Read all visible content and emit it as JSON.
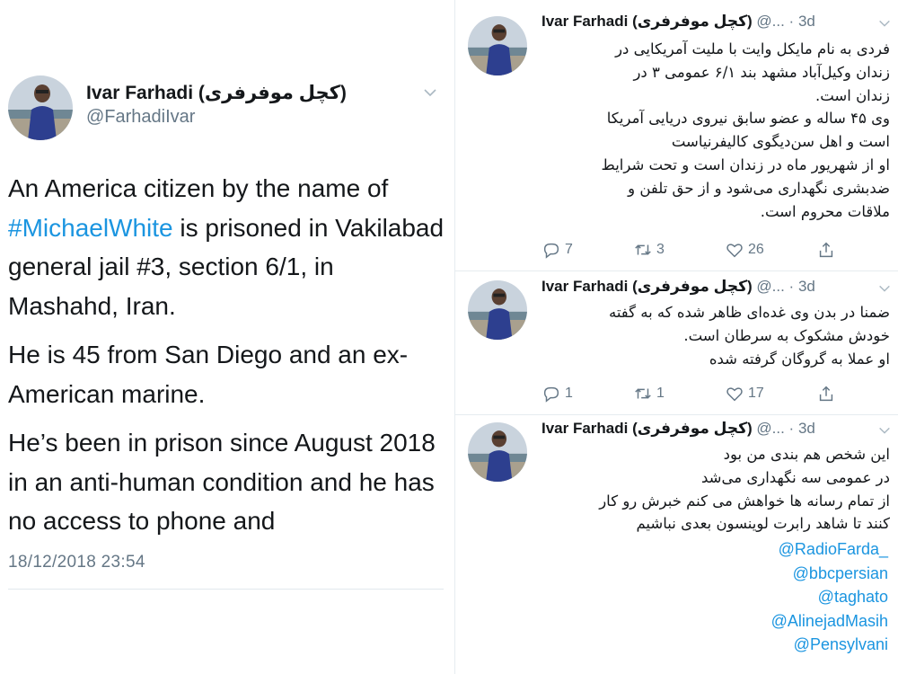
{
  "left_tweet": {
    "display_name": "Ivar Farhadi (کچل موفرفری)",
    "handle": "@FarhadiIvar",
    "paragraph1_pre": "An America citizen by the name of",
    "paragraph1_hashtag": "#MichaelWhite",
    "paragraph1_post": " is prisoned in Vakilabad general jail #3, section 6/1, in Mashahd, Iran.",
    "paragraph2": "He is 45 from San Diego and an ex-American marine.",
    "paragraph3": "He’s been in prison since August 2018 in an anti-human condition and he has no access to phone and",
    "timestamp": "18/12/2018 23:54"
  },
  "thread": [
    {
      "display_name": "Ivar Farhadi (کچل موفرفری)",
      "meta": "@... · 3d",
      "lines": [
        "فردی به نام مایکل وایت با ملیت آمریکایی در",
        "زندان وکیل‌آباد مشهد بند ۶/۱ عمومی ۳ در",
        "زندان است.",
        "وی ۴۵ ساله و عضو سابق نیروی دریایی آمریکا",
        "است و اهل سن‌دیگوی کالیفرنیاست",
        "او از شهریور ماه در زندان است و تحت شرایط",
        "ضدبشری نگهداری می‌شود و از حق تلفن و",
        "ملاقات محروم است."
      ],
      "replies": "7",
      "retweets": "3",
      "likes": "26"
    },
    {
      "display_name": "Ivar Farhadi (کچل موفرفری)",
      "meta": "@... · 3d",
      "lines": [
        "ضمنا در بدن وی غده‌ای ظاهر شده که به گفته",
        "خودش مشکوک به سرطان است.",
        "او عملا به گروگان گرفته شده"
      ],
      "replies": "1",
      "retweets": "1",
      "likes": "17"
    },
    {
      "display_name": "Ivar Farhadi (کچل موفرفری)",
      "meta": "@... · 3d",
      "lines": [
        "این شخص هم بندی من بود",
        "در عمومی سه نگهداری می‌شد",
        "از تمام رسانه ها خواهش می کنم خبرش رو کار",
        "کنند تا شاهد رابرت لوینسون بعدی نباشیم"
      ],
      "mentions": [
        "@RadioFarda_",
        "@bbcpersian",
        "@taghato",
        "@AlinejadMasih",
        "@Pensylvani"
      ]
    }
  ],
  "colors": {
    "link": "#1b95e0",
    "secondary_text": "#657786",
    "divider": "#e6ecf0"
  },
  "icons": [
    "chevron-down-icon",
    "reply-icon",
    "retweet-icon",
    "like-icon",
    "share-icon"
  ]
}
